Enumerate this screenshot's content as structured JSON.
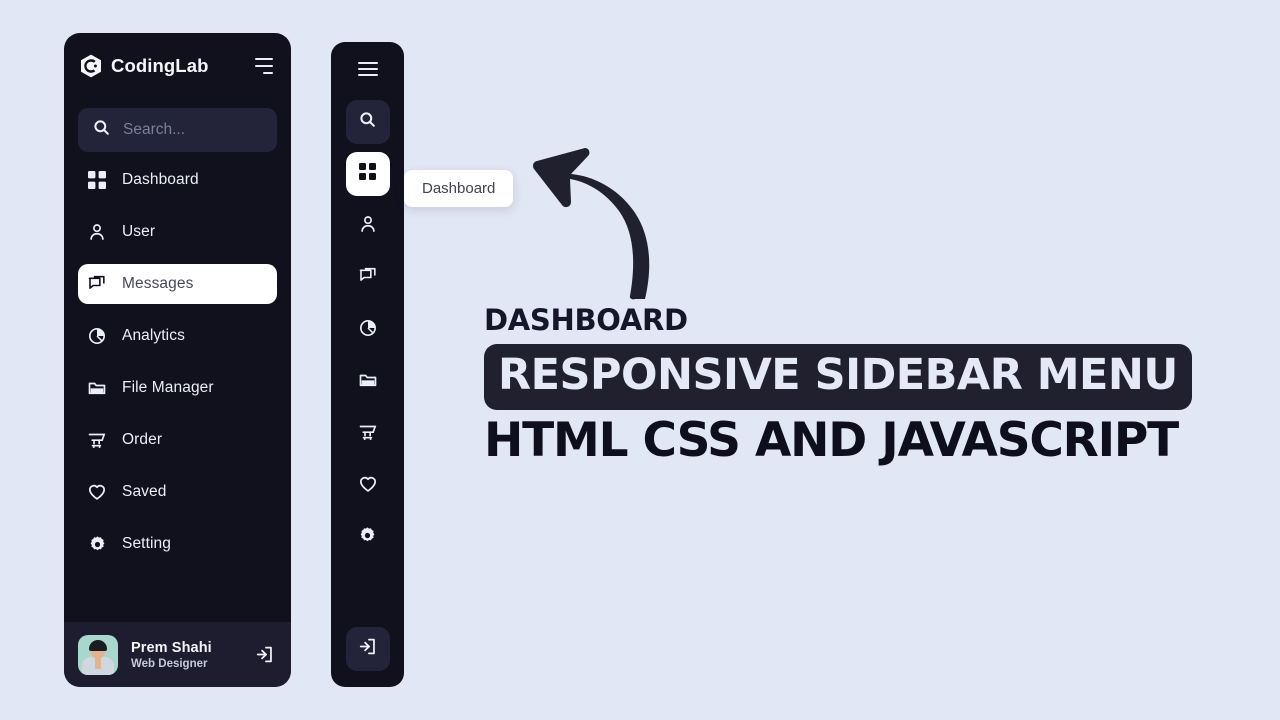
{
  "theme": {
    "page_bg": "#e1e7f4",
    "sidebar_bg": "#11111e",
    "sidebar_soft_bg": "#23233a",
    "active_bg": "#ffffff",
    "active_text": "#44485c",
    "text": "#eceef7",
    "band_bg": "#20202f",
    "band_text": "#e5e8f6"
  },
  "sidebar": {
    "brand": "CodingLab",
    "logo_icon": "hexagon-c-logo-icon",
    "toggle_icon": "menu-toggle-icon",
    "search": {
      "icon": "search-icon",
      "placeholder": "Search...",
      "value": ""
    },
    "items": [
      {
        "label": "Dashboard",
        "icon": "grid-dashboard-icon"
      },
      {
        "label": "User",
        "icon": "user-icon"
      },
      {
        "label": "Messages",
        "icon": "chat-bubble-icon"
      },
      {
        "label": "Analytics",
        "icon": "pie-chart-icon"
      },
      {
        "label": "File Manager",
        "icon": "folder-icon"
      },
      {
        "label": "Order",
        "icon": "shopping-cart-icon"
      },
      {
        "label": "Saved",
        "icon": "heart-icon"
      },
      {
        "label": "Setting",
        "icon": "gear-icon"
      }
    ],
    "active_item": "Messages",
    "profile": {
      "name": "Prem Shahi",
      "role": "Web Designer",
      "avatar_icon": "user-avatar-photo",
      "logout_icon": "logout-icon"
    }
  },
  "sidebar_mini": {
    "toggle_icon": "hamburger-icon",
    "items": [
      {
        "icon": "search-icon",
        "name": "search"
      },
      {
        "icon": "grid-dashboard-icon",
        "name": "dashboard"
      },
      {
        "icon": "user-icon",
        "name": "user"
      },
      {
        "icon": "chat-bubble-icon",
        "name": "messages"
      },
      {
        "icon": "pie-chart-icon",
        "name": "analytics"
      },
      {
        "icon": "folder-icon",
        "name": "file-manager"
      },
      {
        "icon": "shopping-cart-icon",
        "name": "order"
      },
      {
        "icon": "heart-icon",
        "name": "saved"
      },
      {
        "icon": "gear-icon",
        "name": "setting"
      }
    ],
    "active_item": "dashboard",
    "soft_item": "search",
    "logout_icon": "logout-icon"
  },
  "tooltip": {
    "text": "Dashboard"
  },
  "promo": {
    "arrow_icon": "curved-arrow-up-left-icon",
    "kicker": "DASHBOARD",
    "headline": "RESPONSIVE SIDEBAR MENU",
    "subline": "HTML CSS AND JAVASCRIPT"
  }
}
